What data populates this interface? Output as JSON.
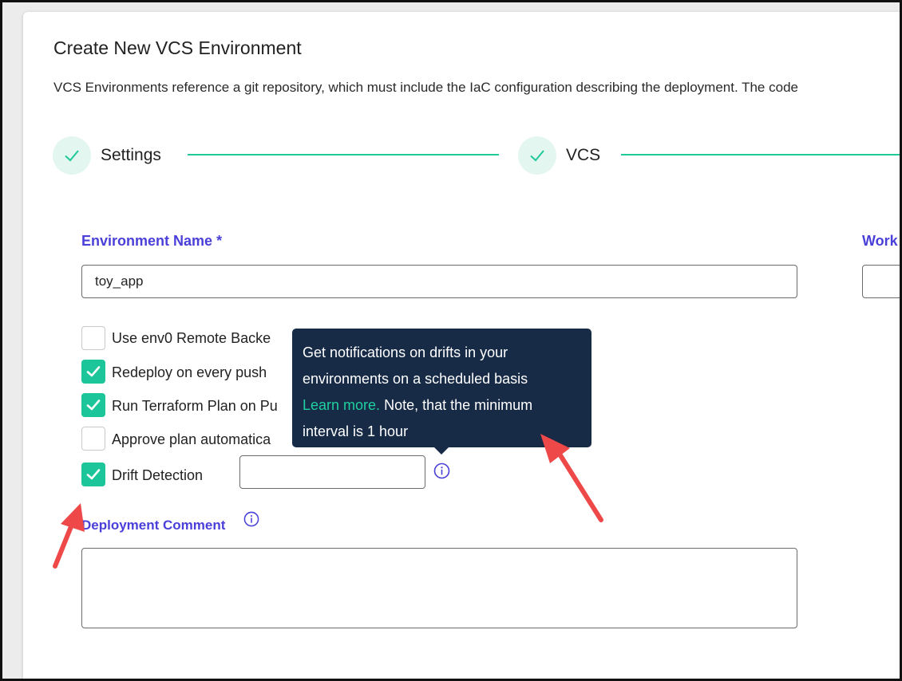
{
  "page": {
    "title": "Create New VCS Environment",
    "description": "VCS Environments reference a git repository, which must include the IaC configuration describing the deployment. The code"
  },
  "stepper": {
    "steps": [
      {
        "label": "Settings",
        "status": "complete"
      },
      {
        "label": "VCS",
        "status": "complete"
      }
    ]
  },
  "form": {
    "environment_name": {
      "label": "Environment Name",
      "required_mark": "*",
      "value": "toy_app"
    },
    "workspace": {
      "label_partial": "Work"
    },
    "options": [
      {
        "label": "Use env0 Remote Backe",
        "checked": false
      },
      {
        "label": "Redeploy on every push",
        "checked": true
      },
      {
        "label": "Run Terraform Plan on Pu",
        "checked": true
      },
      {
        "label": "Approve plan automatica",
        "checked": false
      },
      {
        "label": "Drift Detection",
        "checked": true
      }
    ],
    "drift_interval": {
      "value": ""
    },
    "deployment_comment": {
      "label": "Deployment Comment",
      "value": ""
    }
  },
  "tooltip": {
    "line1": "Get notifications on drifts in your",
    "line2": "environments on a scheduled basis",
    "link": "Learn more.",
    "line3_rest": " Note, that the minimum",
    "line4": "interval is 1 hour"
  },
  "colors": {
    "accent": "#1cc69a",
    "label_purple": "#4a3fd8",
    "tooltip_bg": "#172a46",
    "arrow_red": "#ee4848"
  },
  "icons": {
    "step_check": "check-icon",
    "checkbox_check": "check-icon",
    "info": "info-circle-icon",
    "annotation": "red-arrow"
  }
}
